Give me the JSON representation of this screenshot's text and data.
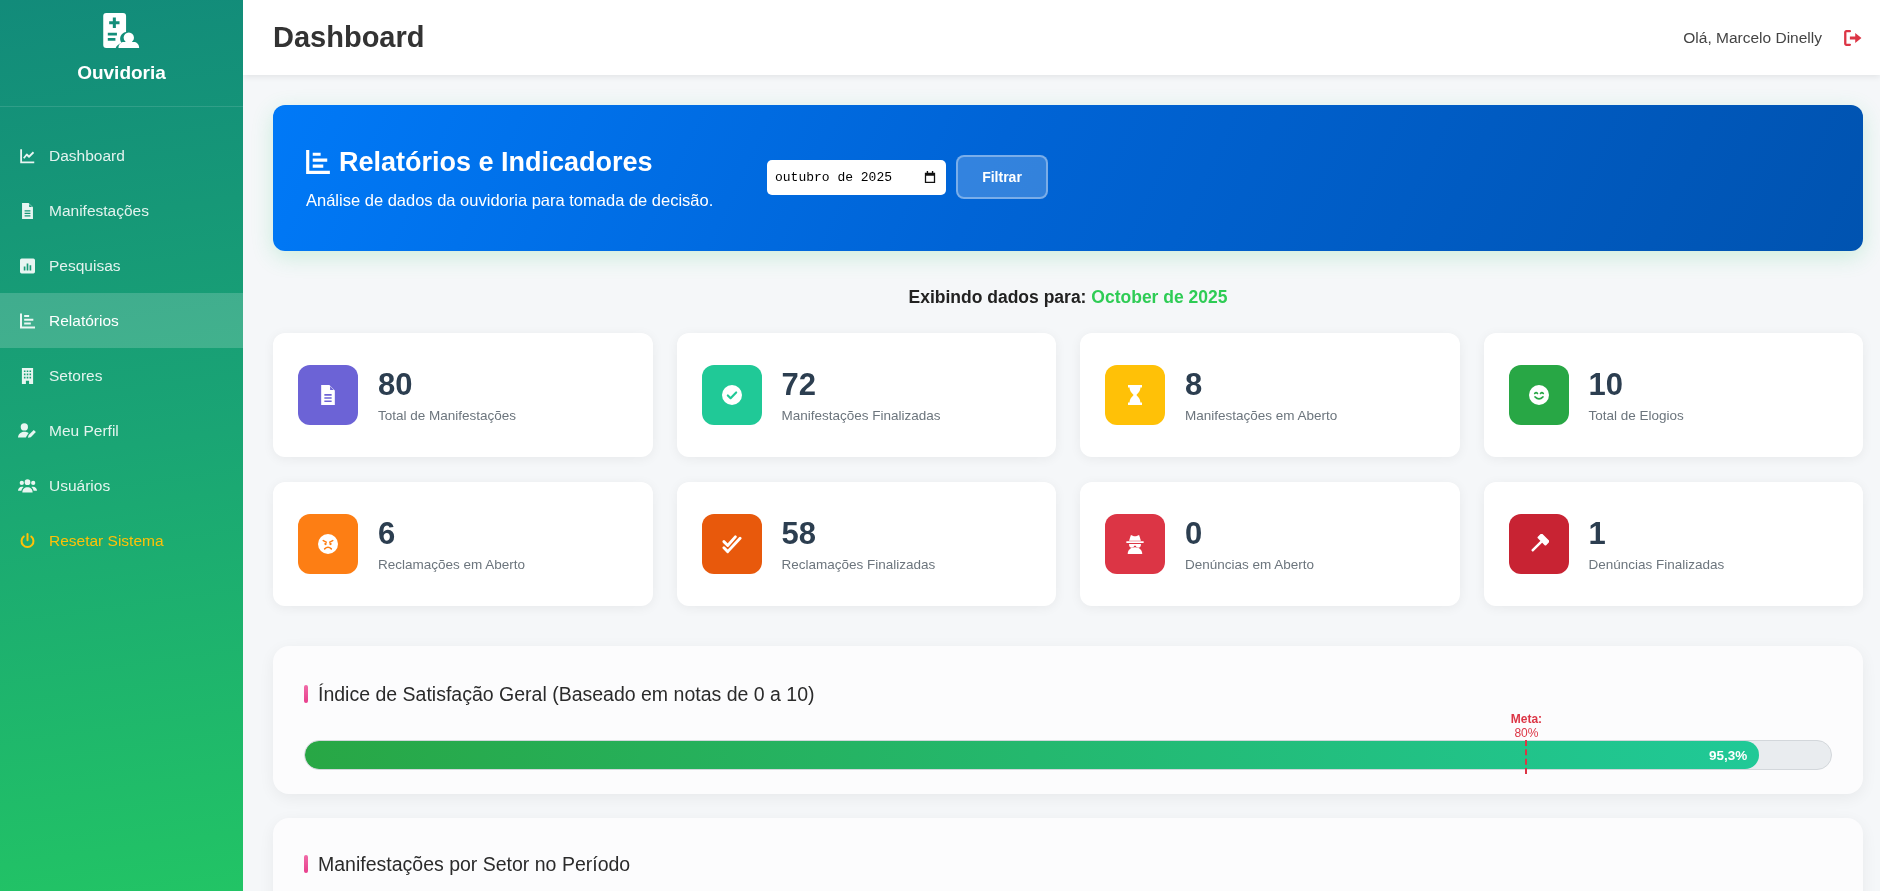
{
  "sidebar": {
    "title": "Ouvidoria",
    "items": [
      {
        "label": "Dashboard",
        "selected": false,
        "kind": "nav"
      },
      {
        "label": "Manifestações",
        "selected": false,
        "kind": "nav"
      },
      {
        "label": "Pesquisas",
        "selected": false,
        "kind": "nav"
      },
      {
        "label": "Relatórios",
        "selected": true,
        "kind": "nav"
      },
      {
        "label": "Setores",
        "selected": false,
        "kind": "nav"
      },
      {
        "label": "Meu Perfil",
        "selected": false,
        "kind": "nav"
      },
      {
        "label": "Usuários",
        "selected": false,
        "kind": "nav"
      },
      {
        "label": "Resetar Sistema",
        "selected": false,
        "kind": "action"
      }
    ]
  },
  "header": {
    "title": "Dashboard",
    "greeting": "Olá, Marcelo Dinelly"
  },
  "banner": {
    "title": "Relatórios e Indicadores",
    "subtitle": "Análise de dados da ouvidoria para tomada de decisão.",
    "month_field": {
      "value": "outubro de 2025"
    },
    "filter_button": "Filtrar"
  },
  "period": {
    "label": "Exibindo dados para:",
    "value": "October de 2025"
  },
  "stats": [
    {
      "value": "80",
      "label": "Total de Manifestações",
      "color": "#6c63d6"
    },
    {
      "value": "72",
      "label": "Manifestações Finalizadas",
      "color": "#20c997"
    },
    {
      "value": "8",
      "label": "Manifestações em Aberto",
      "color": "#ffc107"
    },
    {
      "value": "10",
      "label": "Total de Elogios",
      "color": "#28a745"
    },
    {
      "value": "6",
      "label": "Reclamações em Aberto",
      "color": "#fd7e14"
    },
    {
      "value": "58",
      "label": "Reclamações Finalizadas",
      "color": "#e8590c"
    },
    {
      "value": "0",
      "label": "Denúncias em Aberto",
      "color": "#dc3545"
    },
    {
      "value": "1",
      "label": "Denúncias Finalizadas",
      "color": "#c82333"
    }
  ],
  "satisfaction": {
    "title": "Índice de Satisfação Geral (Baseado em notas de 0 a 10)",
    "level": 0.953,
    "reading": "95,3%",
    "target": {
      "label": "Meta:",
      "value": "80%",
      "level": 0.8
    }
  },
  "sector_section": {
    "title": "Manifestações por Setor no Período"
  }
}
